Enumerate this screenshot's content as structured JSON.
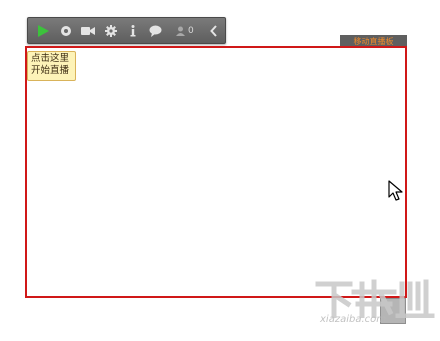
{
  "toolbar": {
    "buttons": [
      {
        "name": "play-icon",
        "color": "#3cc23c"
      },
      {
        "name": "record-icon"
      },
      {
        "name": "camera-icon"
      },
      {
        "name": "gear-icon"
      },
      {
        "name": "info-icon",
        "glyph": "i"
      },
      {
        "name": "chat-icon"
      },
      {
        "name": "user-icon"
      },
      {
        "name": "chevron-left-icon",
        "glyph": "<"
      }
    ],
    "viewer_count": "0"
  },
  "mobile_live_button": "移动直播板",
  "tooltip": {
    "line1": "点击这里",
    "line2": "开始直播"
  },
  "colors": {
    "stage_border": "#d01818",
    "play_green": "#3cc23c",
    "mobile_text": "#f08a2a",
    "tooltip_bg": "#fdf3b8"
  },
  "watermark": {
    "logo": "下载",
    "text": "xiazaiba.com"
  }
}
